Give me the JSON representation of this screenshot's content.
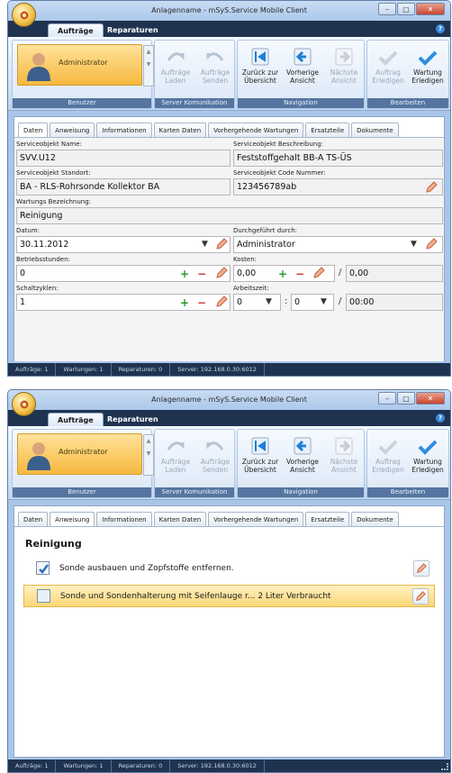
{
  "app": {
    "title": "Anlagenname - mSyS.Service Mobile Client"
  },
  "ribbon_tabs": [
    "Aufträge",
    "Reparaturen"
  ],
  "ribbon": {
    "user_name": "Administrator",
    "groups": {
      "benutzer": "Benutzer",
      "server": "Server Komunikation",
      "navigation": "Navigation",
      "bearbeiten": "Bearbeiten"
    },
    "buttons": {
      "laden": [
        "Aufträge",
        "Laden"
      ],
      "senden": [
        "Aufträge",
        "Senden"
      ],
      "zurueck": [
        "Zurück zur",
        "Übersicht"
      ],
      "vorherige": [
        "Vorherige",
        "Ansicht"
      ],
      "naechste": [
        "Nächste",
        "Ansicht"
      ],
      "auftrag_erledigen": [
        "Auftrag",
        "Erledigen"
      ],
      "wartung_erledigen": [
        "Wartung",
        "Erledigen"
      ]
    }
  },
  "subtabs": [
    "Daten",
    "Anweisung",
    "Informationen",
    "Karten Daten",
    "Vorhergehende Wartungen",
    "Ersatzteile",
    "Dokumente"
  ],
  "form": {
    "serviceobjekt_name": {
      "label": "Serviceobjekt Name:",
      "value": "SVV.U12"
    },
    "serviceobjekt_beschreibung": {
      "label": "Serviceobjekt Beschreibung:",
      "value": "Feststoffgehalt BB-A TS-ÜS"
    },
    "serviceobjekt_standort": {
      "label": "Serviceobjekt Standort:",
      "value": "BA - RLS-Rohrsonde Kollektor BA"
    },
    "serviceobjekt_code": {
      "label": "Serviceobjekt Code Nummer:",
      "value": "123456789ab"
    },
    "wartungs_bezeichnung": {
      "label": "Wartungs Bezeichnung:",
      "value": "Reinigung"
    },
    "datum": {
      "label": "Datum:",
      "value": "30.11.2012"
    },
    "durchgefuehrt": {
      "label": "Durchgeführt durch:",
      "value": "Administrator"
    },
    "betriebsstunden": {
      "label": "Betriebsstunden:",
      "value": "0"
    },
    "kosten": {
      "label": "Kosten:",
      "value": "0,00",
      "total": "0,00"
    },
    "schaltzyklen": {
      "label": "Schaltzyklen:",
      "value": "1"
    },
    "arbeitszeit": {
      "label": "Arbeitszeit:",
      "hours": "0",
      "minutes": "0",
      "total": "00:00"
    }
  },
  "checklist": {
    "heading": "Reinigung",
    "items": [
      {
        "text": "Sonde ausbauen und Zopfstoffe entfernen.",
        "checked": true
      },
      {
        "text": "Sonde und Sondenhalterung mit Seifenlauge r...  2 Liter Verbraucht",
        "checked": false
      }
    ]
  },
  "status": {
    "auftraege": "Aufträge: 1",
    "wartungen": "Wartungen: 1",
    "reparaturen": "Reparaturen: 0",
    "server": "Server: 192.168.0.30:6012"
  },
  "colors": {
    "accent": "#f6b93f",
    "ribbon_dark": "#1f3350",
    "frame": "#a9c6ea",
    "plus": "#2a9a2a",
    "minus": "#cc3333"
  }
}
